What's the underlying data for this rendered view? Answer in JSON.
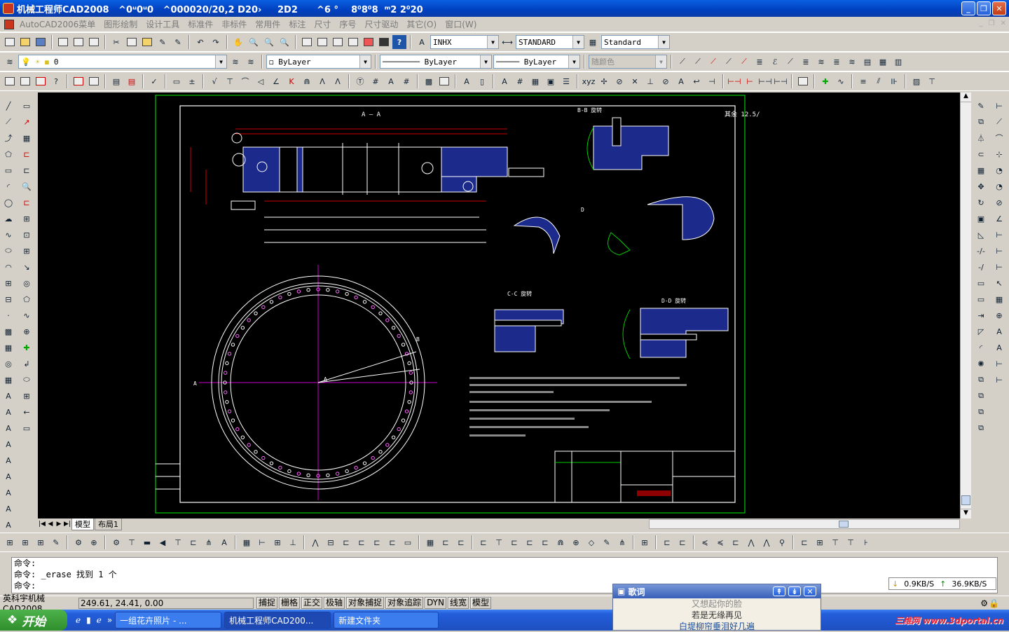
{
  "window": {
    "title": "机械工程师CAD2008   ^0ᵘ0ᵘ0   ^000020/20,2 D20›     2D2      ^6 °    8⁰8⁰8  ᵐ2 2⁰20"
  },
  "menu": [
    "AutoCAD2006菜单",
    "图形绘制",
    "设计工具",
    "标准件",
    "非标件",
    "常用件",
    "标注",
    "尺寸",
    "序号",
    "尺寸驱动",
    "其它(O)",
    "窗口(W)"
  ],
  "toolbar": {
    "textstyle": "INHX",
    "dimstyle": "STANDARD",
    "tablestyle": "Standard",
    "layer": "0",
    "color": "ByLayer",
    "linetype": "ByLayer",
    "lineweight": "ByLayer",
    "plotstyle": "随颜色"
  },
  "tabs": {
    "model": "模型",
    "layout": "布局1"
  },
  "command": {
    "lines": [
      "命令:",
      "命令: _erase 找到 1 个",
      "命令:"
    ]
  },
  "status": {
    "app": "英科宇机械CAD2008",
    "coords": "249.61, 24.41, 0.00",
    "buttons": [
      "捕捉",
      "栅格",
      "正交",
      "极轴",
      "对象捕捉",
      "对象追踪",
      "DYN",
      "线宽",
      "模型"
    ]
  },
  "taskbar": {
    "start": "开始",
    "tasks": [
      "一组花卉照片 - ...",
      "机械工程师CAD200...",
      "新建文件夹"
    ],
    "watermark": "三维网 www.3dportal.cn"
  },
  "lyric": {
    "title": "歌词",
    "lines": [
      "又想起你的脸",
      "若是无缘再见",
      "白堤柳帘垂泪好几遍"
    ]
  },
  "net": {
    "down": "0.9KB/S",
    "up": "36.9KB/S"
  },
  "drawing": {
    "sec_aa": "A — A",
    "sec_bb": "B-B 旋转",
    "sec_cc": "C-C 旋转",
    "sec_dd": "D-D 旋转",
    "label_a": "A",
    "label_b": "B",
    "label_d": "D",
    "ra": "其余 12.5/"
  }
}
